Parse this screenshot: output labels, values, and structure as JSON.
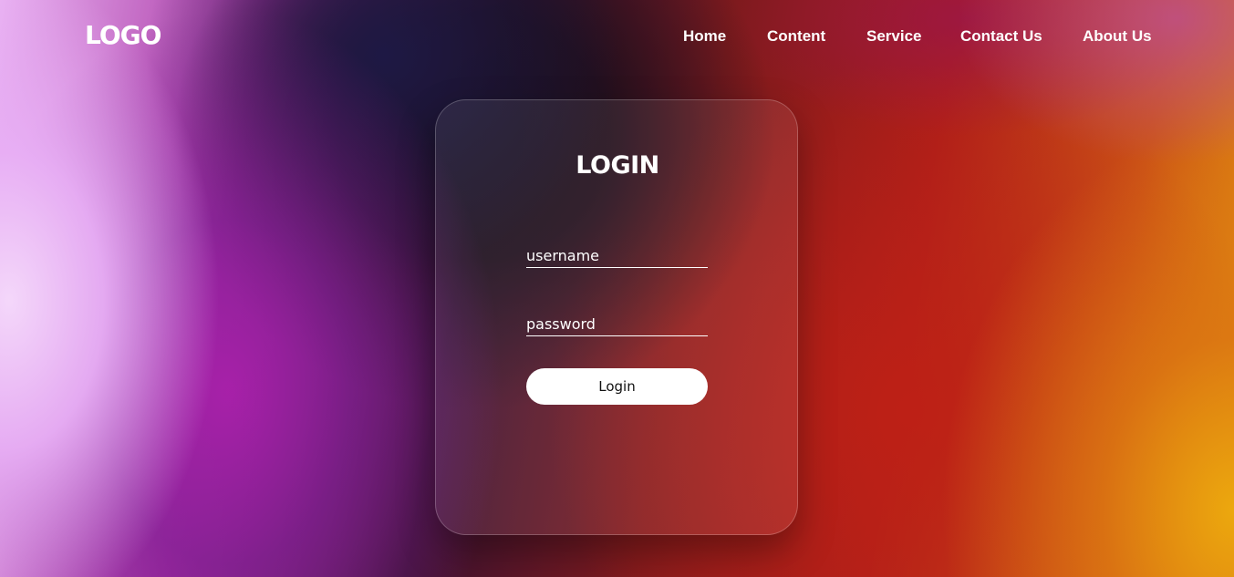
{
  "header": {
    "logo": "LOGO",
    "nav": [
      "Home",
      "Content",
      "Service",
      "Contact Us",
      "About Us"
    ]
  },
  "login": {
    "title": "LOGIN",
    "username_placeholder": "username",
    "password_placeholder": "password",
    "button_label": "Login"
  },
  "colors": {
    "text": "#ffffff",
    "button_bg": "#ffffff",
    "button_text": "#111111"
  }
}
